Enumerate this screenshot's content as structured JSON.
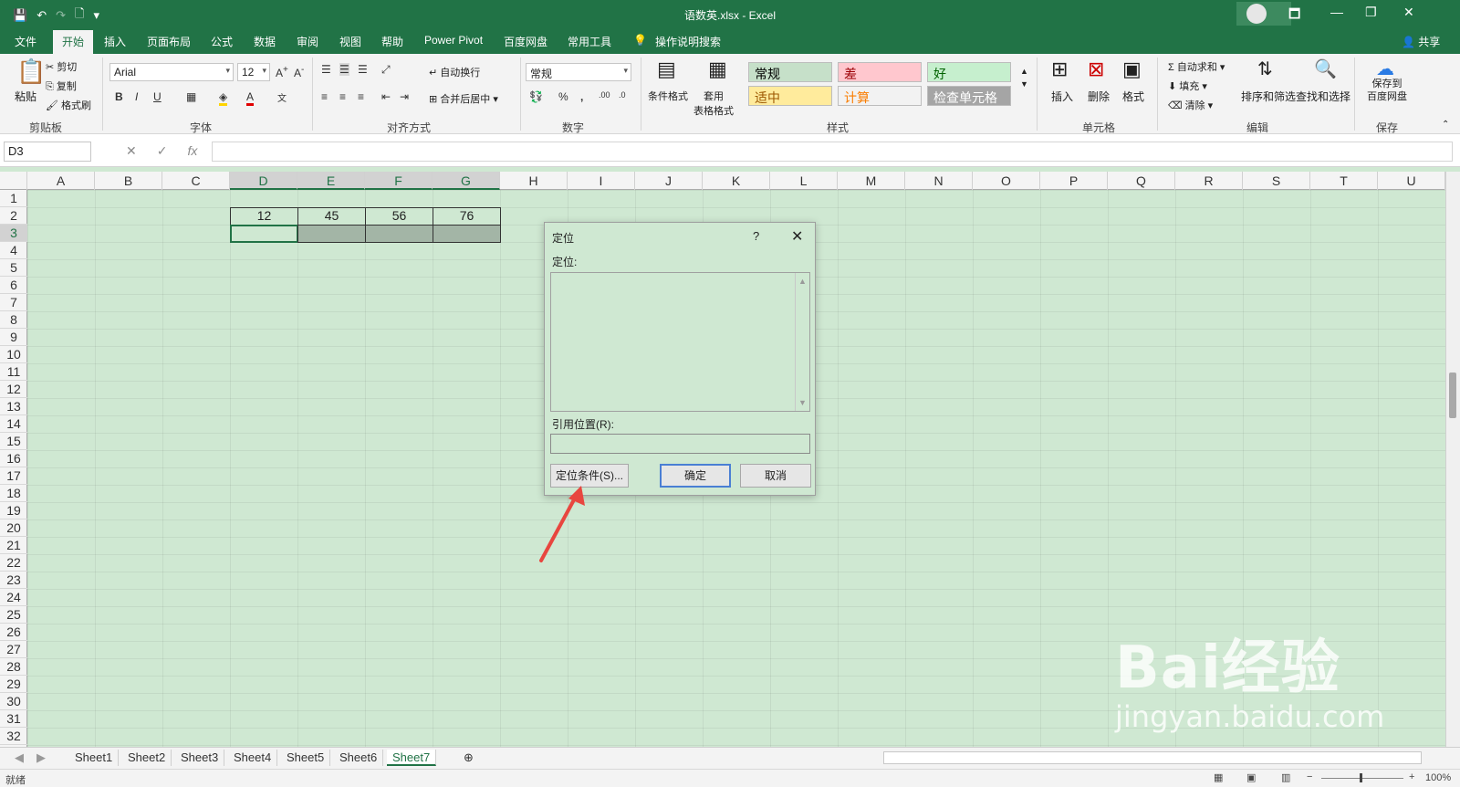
{
  "app": {
    "title": "语数英.xlsx  -  Excel",
    "share_label": "共享"
  },
  "tabs": [
    "文件",
    "开始",
    "插入",
    "页面布局",
    "公式",
    "数据",
    "审阅",
    "视图",
    "帮助",
    "Power Pivot",
    "百度网盘",
    "常用工具",
    "操作说明搜索"
  ],
  "ribbon": {
    "clipboard": {
      "paste": "粘贴",
      "cut": "剪切",
      "copy": "复制",
      "format_painter": "格式刷",
      "label": "剪贴板"
    },
    "font": {
      "name": "Arial",
      "size": "12",
      "label": "字体"
    },
    "alignment": {
      "wrap": "自动换行",
      "merge": "合并后居中",
      "label": "对齐方式"
    },
    "number": {
      "format": "常规",
      "label": "数字"
    },
    "styles": {
      "cond_format": "条件格式",
      "table_format": "套用\n表格格式",
      "cells": [
        {
          "text": "常规",
          "bg": "#c6e0c9",
          "color": "#000000"
        },
        {
          "text": "差",
          "bg": "#ffc7ce",
          "color": "#9c0006"
        },
        {
          "text": "好",
          "bg": "#c6efce",
          "color": "#006100"
        },
        {
          "text": "适中",
          "bg": "#ffeb9c",
          "color": "#9c5700"
        },
        {
          "text": "计算",
          "bg": "#f2f2f2",
          "color": "#fa7d00"
        },
        {
          "text": "检查单元格",
          "bg": "#a5a5a5",
          "color": "#ffffff"
        }
      ],
      "label": "样式"
    },
    "cells_group": {
      "insert": "插入",
      "delete": "删除",
      "format": "格式",
      "label": "单元格"
    },
    "editing": {
      "autosum": "自动求和",
      "fill": "填充",
      "clear": "清除",
      "sort": "排序和筛选",
      "find": "查找和选择",
      "label": "编辑"
    },
    "save": {
      "text": "保存到\n百度网盘",
      "label": "保存"
    }
  },
  "formula_bar": {
    "name_box": "D3",
    "formula": ""
  },
  "columns": [
    "A",
    "B",
    "C",
    "D",
    "E",
    "F",
    "G",
    "H",
    "I",
    "J",
    "K",
    "L",
    "M",
    "N",
    "O",
    "P",
    "Q",
    "R",
    "S",
    "T",
    "U"
  ],
  "rows": [
    "1",
    "2",
    "3",
    "4",
    "5",
    "6",
    "7",
    "8",
    "9",
    "10",
    "11",
    "12",
    "13",
    "14",
    "15",
    "16",
    "17",
    "18",
    "19",
    "20",
    "21",
    "22",
    "23",
    "24",
    "25",
    "26",
    "27",
    "28",
    "29",
    "30",
    "31",
    "32"
  ],
  "cell_values": {
    "D2": "12",
    "E2": "45",
    "F2": "56",
    "G2": "76"
  },
  "dialog": {
    "title": "定位",
    "help": "?",
    "list_label": "定位:",
    "ref_label": "引用位置(R):",
    "special_button": "定位条件(S)...",
    "ok_button": "确定",
    "cancel_button": "取消"
  },
  "sheets": [
    "Sheet1",
    "Sheet2",
    "Sheet3",
    "Sheet4",
    "Sheet5",
    "Sheet6",
    "Sheet7"
  ],
  "active_sheet": "Sheet7",
  "status": {
    "ready": "就绪",
    "zoom": "100%"
  },
  "watermark": {
    "brand": "Bai经验",
    "url": "jingyan.baidu.com"
  },
  "colors": {
    "excel_green": "#217346",
    "sheet_bg": "#cfe8d2"
  }
}
